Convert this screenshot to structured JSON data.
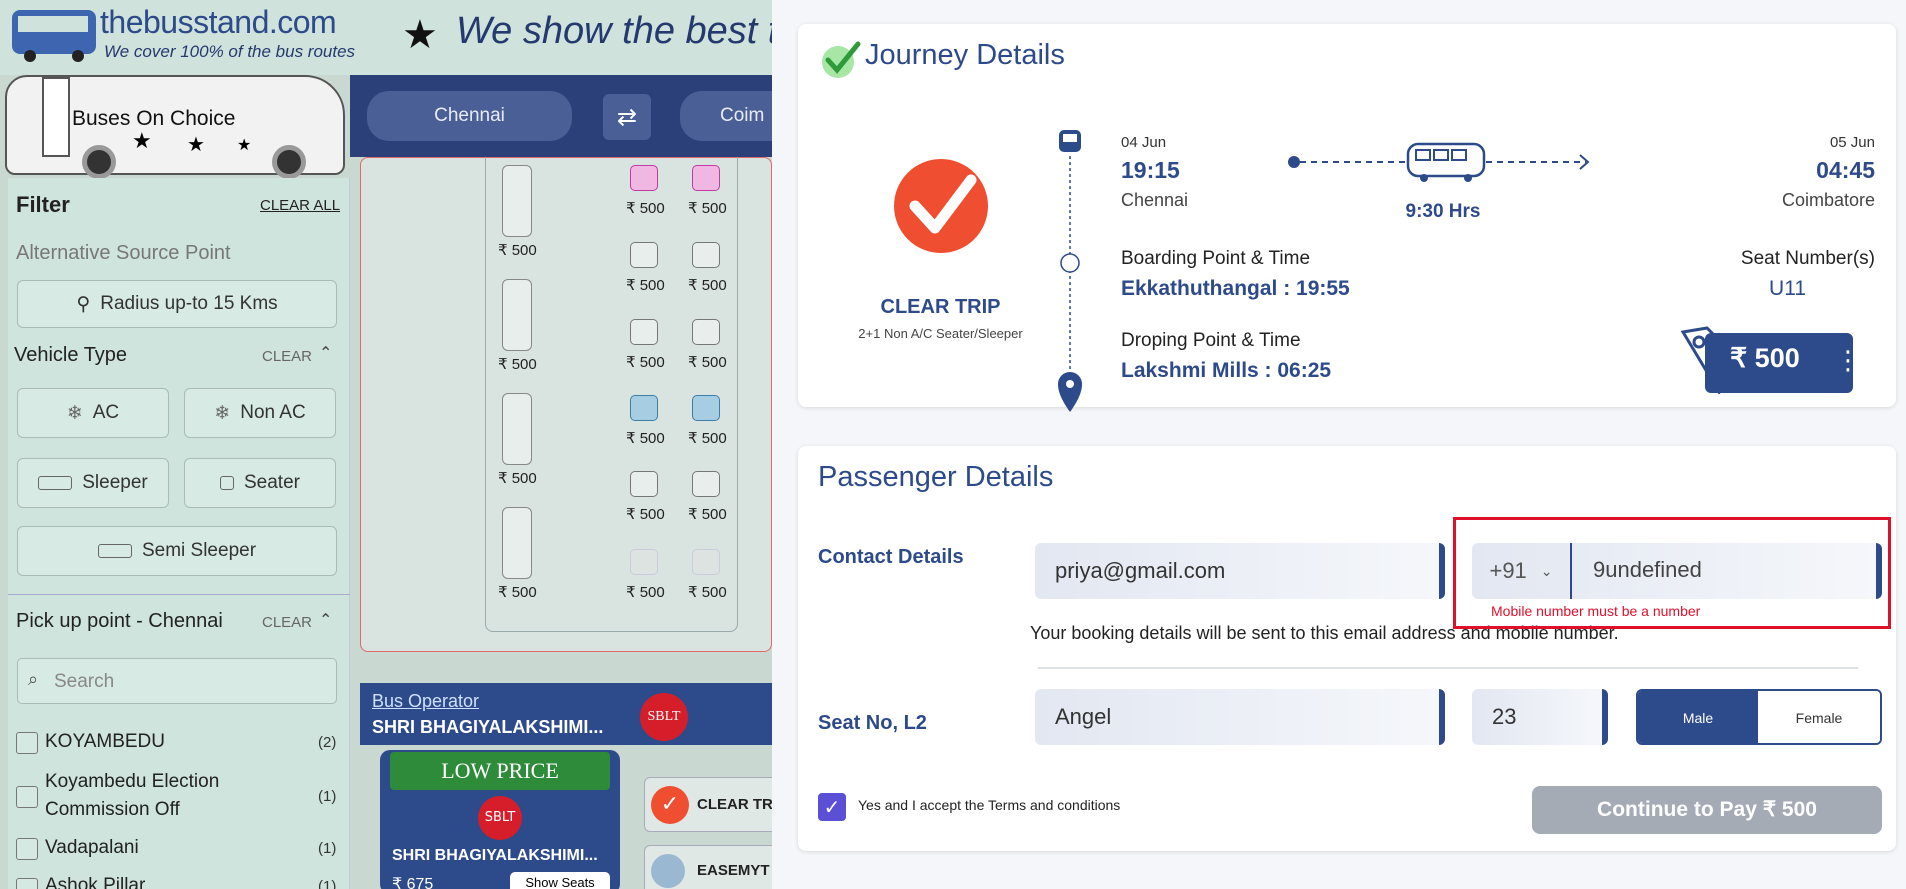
{
  "background": {
    "logo": {
      "title": "thebusstand.com",
      "subtitle": "We cover 100% of the bus routes"
    },
    "tagline": "We show the best ti",
    "bus_banner": "Buses On Choice",
    "nav": {
      "from": "Chennai",
      "to": "Coim"
    },
    "filter": {
      "title": "Filter",
      "clear_all": "CLEAR ALL",
      "alt_source": "Alternative Source Point",
      "radius_btn": "Radius up-to 15 Kms",
      "vehicle_type": "Vehicle Type",
      "clear": "CLEAR",
      "ac": "AC",
      "non_ac": "Non AC",
      "sleeper": "Sleeper",
      "seater": "Seater",
      "semi_sleeper": "Semi Sleeper",
      "pickup_title": "Pick up point - Chennai",
      "pickup_clear": "CLEAR",
      "search_placeholder": "Search",
      "pickups": [
        {
          "name": "KOYAMBEDU",
          "count": "(2)"
        },
        {
          "name": "Koyambedu Election Commission Off",
          "count": "(1)"
        },
        {
          "name": "Vadapalani",
          "count": "(1)"
        },
        {
          "name": "Ashok Pillar",
          "count": "(1)"
        }
      ]
    },
    "seat_price": "₹ 500",
    "operator": {
      "label": "Bus Operator",
      "name": "SHRI BHAGIYALAKSHIMI...",
      "banner": "LOW PRICE",
      "card_name": "SHRI BHAGIYALAKSHIMI...",
      "price": "₹ 675",
      "show_seats": "Show Seats",
      "other1": "CLEAR TR",
      "other2": "EASEMYT"
    }
  },
  "journey": {
    "title": "Journey Details",
    "operator": "CLEAR TRIP",
    "bus_type": "2+1 Non A/C Seater/Sleeper",
    "dep_date": "04 Jun",
    "dep_time": "19:15",
    "dep_city": "Chennai",
    "duration": "9:30 Hrs",
    "arr_date": "05 Jun",
    "arr_time": "04:45",
    "arr_city": "Coimbatore",
    "boarding_label": "Boarding Point & Time",
    "boarding_value": "Ekkathuthangal : 19:55",
    "seat_label": "Seat Number(s)",
    "seat_value": "U11",
    "dropping_label": "Droping Point & Time",
    "dropping_value": "Lakshmi Mills : 06:25",
    "fare": "₹ 500"
  },
  "passenger": {
    "title": "Passenger Details",
    "contact_label": "Contact Details",
    "email": "priya@gmail.com",
    "country_code": "+91",
    "mobile": "9undefined",
    "mobile_error": "Mobile number must be a number",
    "info_note": "Your booking details will be sent to this email address and mobile number.",
    "seat_label": "Seat No, L2",
    "name": "Angel",
    "age": "23",
    "male": "Male",
    "female": "Female",
    "terms": "Yes and I accept the Terms and conditions",
    "continue_btn": "Continue to Pay ₹ 500"
  },
  "colors": {
    "navy": "#2d4a8a",
    "error": "#e0102b",
    "check": "#5b4fd6",
    "brand_red": "#f04e30"
  }
}
